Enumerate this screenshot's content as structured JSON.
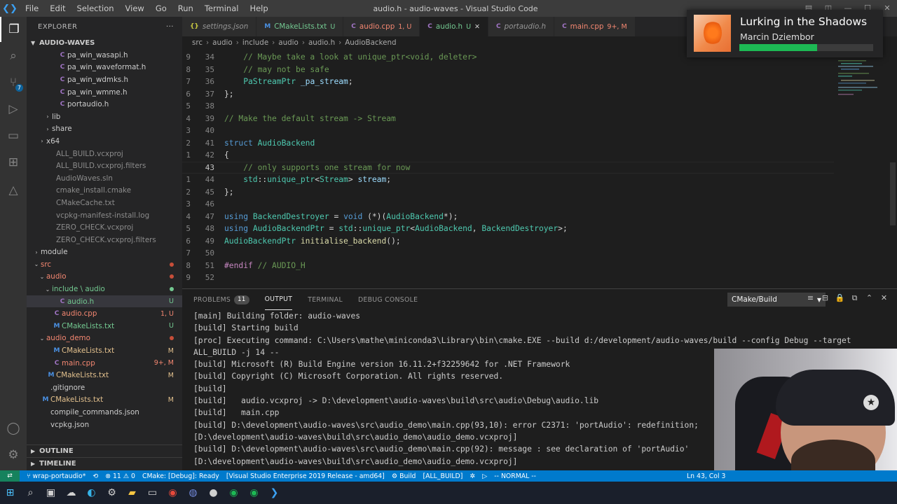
{
  "window": {
    "title": "audio.h - audio-waves - Visual Studio Code",
    "menu": [
      "File",
      "Edit",
      "Selection",
      "View",
      "Go",
      "Run",
      "Terminal",
      "Help"
    ]
  },
  "sidebar": {
    "header": "EXPLORER",
    "root": "AUDIO-WAVES",
    "items": [
      {
        "label": "pa_win_wasapi.h",
        "icon": "c",
        "indent": 3,
        "color": "def"
      },
      {
        "label": "pa_win_waveformat.h",
        "icon": "c",
        "indent": 3,
        "color": "def"
      },
      {
        "label": "pa_win_wdmks.h",
        "icon": "c",
        "indent": 3,
        "color": "def"
      },
      {
        "label": "pa_win_wmme.h",
        "icon": "c",
        "indent": 3,
        "color": "def"
      },
      {
        "label": "portaudio.h",
        "icon": "c",
        "indent": 3,
        "color": "def"
      },
      {
        "label": "lib",
        "folder": "closed",
        "indent": 2,
        "color": "def"
      },
      {
        "label": "share",
        "folder": "closed",
        "indent": 2,
        "color": "def"
      },
      {
        "label": "x64",
        "folder": "closed",
        "indent": 1,
        "color": "def"
      },
      {
        "label": "ALL_BUILD.vcxproj",
        "icon": "",
        "indent": 1,
        "color": "ign"
      },
      {
        "label": "ALL_BUILD.vcxproj.filters",
        "icon": "",
        "indent": 1,
        "color": "ign"
      },
      {
        "label": "AudioWaves.sln",
        "icon": "",
        "indent": 1,
        "color": "ign"
      },
      {
        "label": "cmake_install.cmake",
        "icon": "",
        "indent": 1,
        "color": "ign"
      },
      {
        "label": "CMakeCache.txt",
        "icon": "",
        "indent": 1,
        "color": "ign"
      },
      {
        "label": "vcpkg-manifest-install.log",
        "icon": "",
        "indent": 1,
        "color": "ign"
      },
      {
        "label": "ZERO_CHECK.vcxproj",
        "icon": "",
        "indent": 1,
        "color": "ign"
      },
      {
        "label": "ZERO_CHECK.vcxproj.filters",
        "icon": "",
        "indent": 1,
        "color": "ign"
      },
      {
        "label": "module",
        "folder": "closed",
        "indent": 0,
        "color": "def"
      },
      {
        "label": "src",
        "folder": "open",
        "indent": 0,
        "color": "err",
        "dot": "#c74e39"
      },
      {
        "label": "audio",
        "folder": "open",
        "indent": 1,
        "color": "err",
        "dot": "#c74e39"
      },
      {
        "label": "include \\ audio",
        "folder": "open",
        "indent": 2,
        "color": "unt",
        "dot": "#73c991"
      },
      {
        "label": "audio.h",
        "icon": "c",
        "indent": 3,
        "color": "unt",
        "status": "U",
        "selected": true
      },
      {
        "label": "audio.cpp",
        "icon": "c",
        "indent": 2,
        "color": "err",
        "status": "1, U"
      },
      {
        "label": "CMakeLists.txt",
        "icon": "cmake",
        "indent": 2,
        "color": "unt",
        "status": "U"
      },
      {
        "label": "audio_demo",
        "folder": "open",
        "indent": 1,
        "color": "err",
        "dot": "#c74e39"
      },
      {
        "label": "CMakeLists.txt",
        "icon": "cmake",
        "indent": 2,
        "color": "mod",
        "status": "M"
      },
      {
        "label": "main.cpp",
        "icon": "c",
        "indent": 2,
        "color": "err",
        "status": "9+, M"
      },
      {
        "label": "CMakeLists.txt",
        "icon": "cmake",
        "indent": 1,
        "color": "mod",
        "status": "M"
      },
      {
        "label": ".gitignore",
        "icon": "",
        "indent": 0,
        "color": "def"
      },
      {
        "label": "CMakeLists.txt",
        "icon": "cmake",
        "indent": 0,
        "color": "mod",
        "status": "M"
      },
      {
        "label": "compile_commands.json",
        "icon": "",
        "indent": 0,
        "color": "def"
      },
      {
        "label": "vcpkg.json",
        "icon": "",
        "indent": 0,
        "color": "def"
      }
    ],
    "outline": "OUTLINE",
    "timeline": "TIMELINE"
  },
  "tabs": [
    {
      "label": "settings.json",
      "icon": "{}",
      "color": "#cbcb41",
      "text_color": "#969696",
      "italic": true
    },
    {
      "label": "CMakeLists.txt",
      "icon": "M",
      "color": "#4a90e2",
      "text_color": "#73c991",
      "status": "U"
    },
    {
      "label": "audio.cpp",
      "icon": "C",
      "color": "#a074c4",
      "text_color": "#f48771",
      "status": "1, U"
    },
    {
      "label": "audio.h",
      "icon": "C",
      "color": "#a074c4",
      "text_color": "#73c991",
      "status": "U",
      "active": true
    },
    {
      "label": "portaudio.h",
      "icon": "C",
      "color": "#a074c4",
      "text_color": "#969696",
      "italic": true
    },
    {
      "label": "main.cpp",
      "icon": "C",
      "color": "#a074c4",
      "text_color": "#f48771",
      "status": "9+, M"
    }
  ],
  "breadcrumb": [
    "src",
    "audio",
    "include",
    "audio",
    "audio.h",
    "AudioBackend"
  ],
  "editor": {
    "lines": [
      {
        "n": "34",
        "tokens": [
          [
            "cm",
            "    // Maybe take a look at unique_ptr<void, deleter>"
          ]
        ]
      },
      {
        "n": "35",
        "tokens": [
          [
            "cm",
            "    // may not be safe"
          ]
        ]
      },
      {
        "n": "36",
        "tokens": [
          [
            "t",
            "    PaStreamPtr"
          ],
          [
            "p",
            " "
          ],
          [
            "v",
            "_pa_stream"
          ],
          [
            "p",
            ";"
          ]
        ]
      },
      {
        "n": "37",
        "tokens": [
          [
            "p",
            "};"
          ]
        ]
      },
      {
        "n": "38",
        "tokens": []
      },
      {
        "n": "39",
        "tokens": [
          [
            "cm",
            "// Make the default stream -> Stream"
          ]
        ]
      },
      {
        "n": "40",
        "tokens": []
      },
      {
        "n": "41",
        "tokens": [
          [
            "k",
            "struct"
          ],
          [
            "p",
            " "
          ],
          [
            "t",
            "AudioBackend"
          ]
        ]
      },
      {
        "n": "42",
        "tokens": [
          [
            "p",
            "{"
          ]
        ]
      },
      {
        "n": "43",
        "tokens": [
          [
            "cm",
            "    // only supports one stream for now"
          ]
        ],
        "current": true
      },
      {
        "n": "44",
        "tokens": [
          [
            "t",
            "    std"
          ],
          [
            "p",
            "::"
          ],
          [
            "t",
            "unique_ptr"
          ],
          [
            "p",
            "<"
          ],
          [
            "t",
            "Stream"
          ],
          [
            "p",
            "> "
          ],
          [
            "v",
            "stream"
          ],
          [
            "p",
            ";"
          ]
        ]
      },
      {
        "n": "45",
        "tokens": [
          [
            "p",
            "};"
          ]
        ]
      },
      {
        "n": "46",
        "tokens": []
      },
      {
        "n": "47",
        "tokens": [
          [
            "k",
            "using"
          ],
          [
            "p",
            " "
          ],
          [
            "t",
            "BackendDestroyer"
          ],
          [
            "p",
            " = "
          ],
          [
            "k",
            "void"
          ],
          [
            "p",
            " (*)("
          ],
          [
            "t",
            "AudioBackend"
          ],
          [
            "p",
            "*);"
          ]
        ]
      },
      {
        "n": "48",
        "tokens": [
          [
            "k",
            "using"
          ],
          [
            "p",
            " "
          ],
          [
            "t",
            "AudioBackendPtr"
          ],
          [
            "p",
            " = "
          ],
          [
            "t",
            "std"
          ],
          [
            "p",
            "::"
          ],
          [
            "t",
            "unique_ptr"
          ],
          [
            "p",
            "<"
          ],
          [
            "t",
            "AudioBackend"
          ],
          [
            "p",
            ", "
          ],
          [
            "t",
            "BackendDestroyer"
          ],
          [
            "p",
            ">;"
          ]
        ]
      },
      {
        "n": "49",
        "tokens": [
          [
            "t",
            "AudioBackendPtr"
          ],
          [
            "p",
            " "
          ],
          [
            "f",
            "initialise_backend"
          ],
          [
            "p",
            "();"
          ]
        ]
      },
      {
        "n": "50",
        "tokens": []
      },
      {
        "n": "51",
        "tokens": [
          [
            "pp",
            "#endif"
          ],
          [
            "cm",
            " // AUDIO_H"
          ]
        ]
      },
      {
        "n": "52",
        "tokens": []
      }
    ],
    "gutter_left": [
      "9",
      "8",
      "7",
      "6",
      "5",
      "4",
      "3",
      "2",
      "1",
      "",
      "1",
      "2",
      "3",
      "4",
      "5",
      "6",
      "7",
      "8",
      "9"
    ]
  },
  "panel": {
    "tabs": [
      {
        "label": "PROBLEMS",
        "count": "11"
      },
      {
        "label": "OUTPUT",
        "active": true
      },
      {
        "label": "TERMINAL"
      },
      {
        "label": "DEBUG CONSOLE"
      }
    ],
    "channel": "CMake/Build",
    "output": [
      "[main] Building folder: audio-waves",
      "[build] Starting build",
      "[proc] Executing command: C:\\Users\\mathe\\miniconda3\\Library\\bin\\cmake.EXE --build d:/development/audio-waves/build --config Debug --target",
      "ALL_BUILD -j 14 --",
      "[build] Microsoft (R) Build Engine version 16.11.2+f32259642 for .NET Framework",
      "[build] Copyright (C) Microsoft Corporation. All rights reserved.",
      "[build]",
      "[build]   audio.vcxproj -> D:\\development\\audio-waves\\build\\src\\audio\\Debug\\audio.lib",
      "[build]   main.cpp",
      "[build] D:\\development\\audio-waves\\src\\audio_demo\\main.cpp(93,10): error C2371: 'portAudio': redefinition;",
      "[D:\\development\\audio-waves\\build\\src\\audio_demo\\audio_demo.vcxproj]",
      "[build] D:\\development\\audio-waves\\src\\audio_demo\\main.cpp(92): message : see declaration of 'portAudio'",
      "[D:\\development\\audio-waves\\build\\src\\audio_demo\\audio_demo.vcxproj]"
    ]
  },
  "notification": {
    "title": "Lurking in the Shadows",
    "artist": "Marcin Dziembor",
    "progress": 0.58,
    "accent": "#1db954"
  },
  "statusbar": {
    "branch": "wrap-portaudio*",
    "sync": "⟲",
    "problems": "⊗ 11 ⚠ 0",
    "cmake": "CMake: [Debug]: Ready",
    "kit": "[Visual Studio Enterprise 2019 Release - amd64]",
    "build": "Build",
    "target": "[ALL_BUILD]",
    "mode": "-- NORMAL --",
    "position": "Ln 43, Col 3"
  },
  "taskbar": [
    "windows-icon",
    "search-icon",
    "taskview-icon",
    "weather-icon",
    "edge-icon",
    "settings-icon",
    "explorer-icon",
    "terminal-icon",
    "chrome-icon",
    "discord-icon",
    "github-icon",
    "spotify-icon",
    "spotify-green-icon",
    "vscode-icon"
  ]
}
